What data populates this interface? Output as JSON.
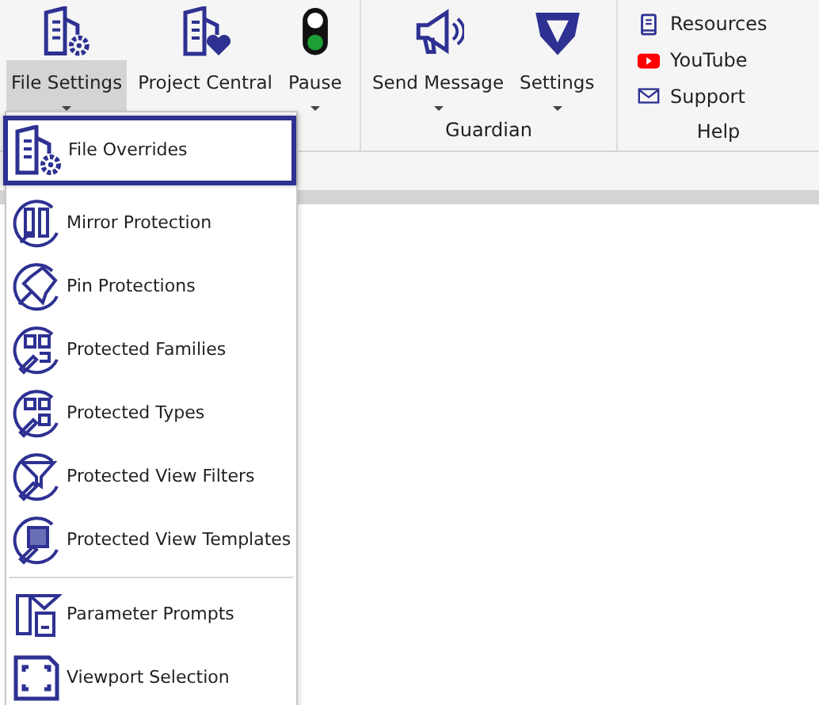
{
  "ribbon": {
    "groups": [
      {
        "buttons": [
          {
            "label": "File Settings",
            "kind": "building-gear",
            "dropdown": true,
            "pressed": true
          },
          {
            "label": "Project Central",
            "kind": "building-heart",
            "dropdown": false,
            "pressed": false
          },
          {
            "label": "Pause",
            "kind": "traffic-light",
            "dropdown": true,
            "pressed": false
          }
        ]
      },
      {
        "label": "Guardian",
        "buttons": [
          {
            "label": "Send Message",
            "kind": "megaphone",
            "dropdown": true,
            "pressed": false
          },
          {
            "label": "Settings",
            "kind": "shield",
            "dropdown": true,
            "pressed": false
          }
        ]
      },
      {
        "label": "Help",
        "links": [
          {
            "label": "Resources",
            "kind": "book"
          },
          {
            "label": "YouTube",
            "kind": "youtube"
          },
          {
            "label": "Support",
            "kind": "mail"
          }
        ]
      }
    ]
  },
  "menu": {
    "sections": [
      [
        {
          "label": "File Overrides",
          "kind": "building-gear",
          "selected": true
        },
        {
          "label": "Mirror Protection",
          "kind": "mirror",
          "selected": false
        },
        {
          "label": "Pin Protections",
          "kind": "pin",
          "selected": false
        },
        {
          "label": "Protected Families",
          "kind": "families",
          "selected": false
        },
        {
          "label": "Protected Types",
          "kind": "types",
          "selected": false
        },
        {
          "label": "Protected View Filters",
          "kind": "filter",
          "selected": false
        },
        {
          "label": "Protected View Templates",
          "kind": "template",
          "selected": false
        }
      ],
      [
        {
          "label": "Parameter Prompts",
          "kind": "prompt",
          "selected": false
        },
        {
          "label": "Viewport Selection",
          "kind": "viewport",
          "selected": false
        }
      ]
    ]
  }
}
